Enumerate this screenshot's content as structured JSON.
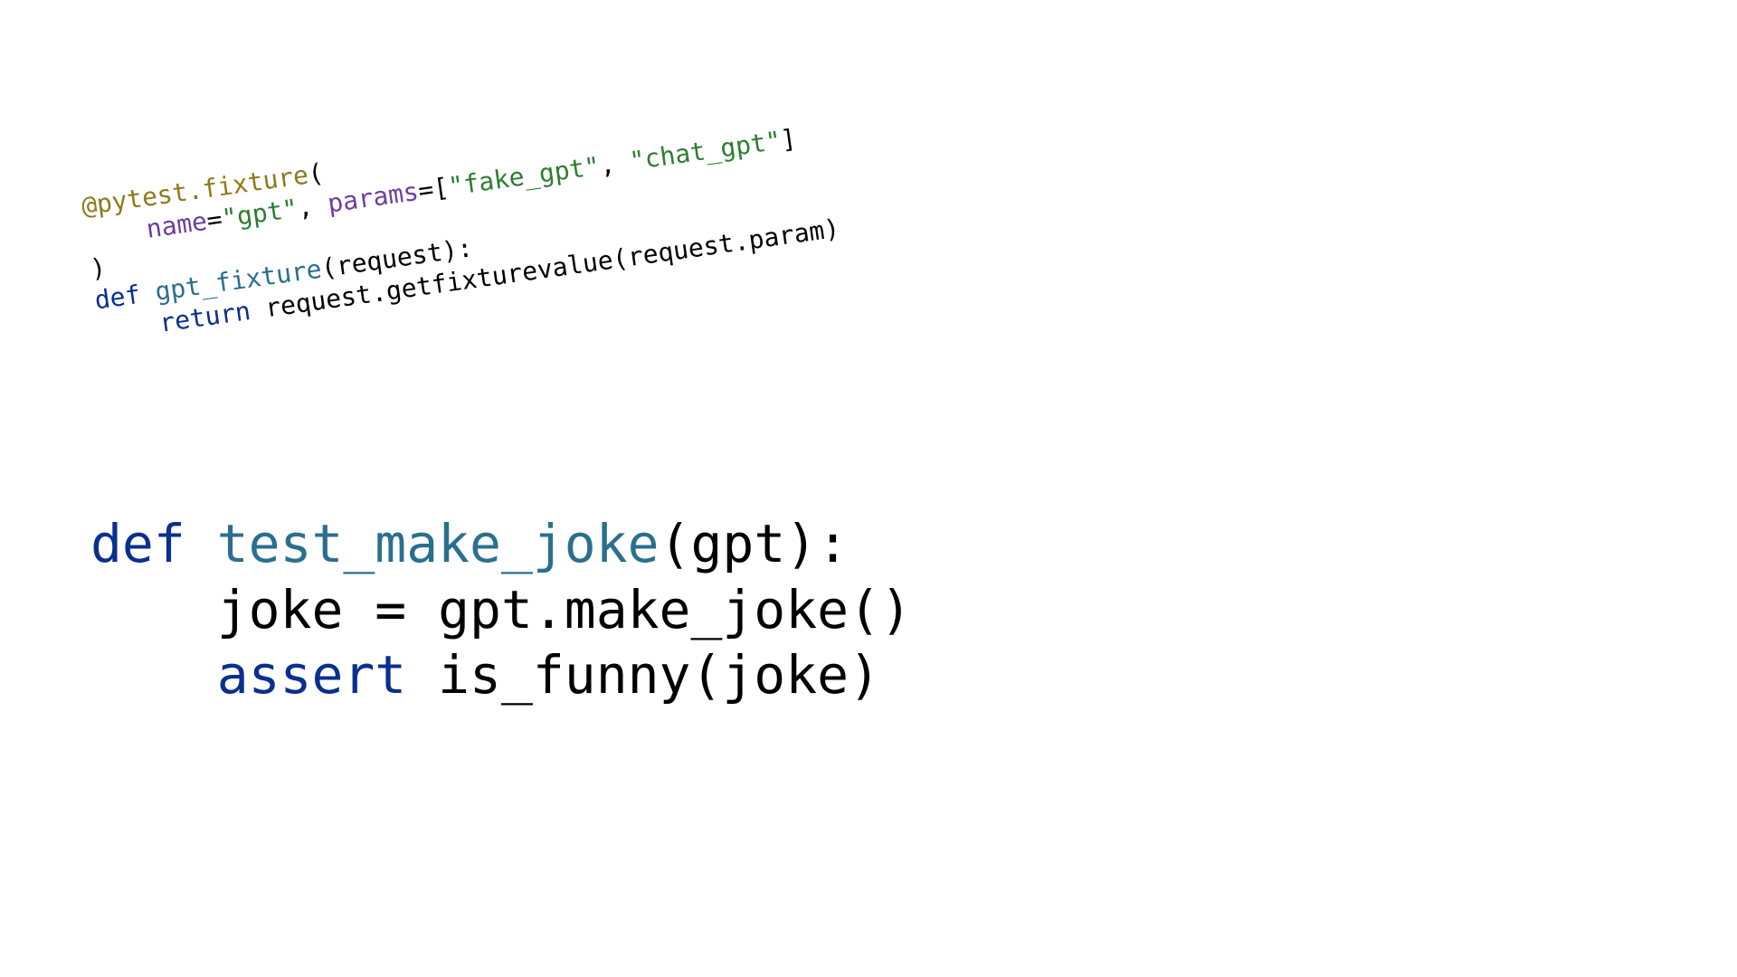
{
  "small": {
    "decorator": "@pytest.fixture",
    "lparen": "(",
    "indent1": "    ",
    "kw_name": "name",
    "eq1": "=",
    "val_name": "\"gpt\"",
    "comma_sp": ", ",
    "kw_params": "params",
    "eq2": "=[",
    "val_p1": "\"fake_gpt\"",
    "val_p2": "\"chat_gpt\"",
    "close_list": "]",
    "rparen": ")",
    "def_kw": "def",
    "sp": " ",
    "fname": "gpt_fixture",
    "sig": "(request):",
    "indent2": "    ",
    "return_kw": "return",
    "ret_expr": " request.getfixturevalue(request.param)"
  },
  "big": {
    "def_kw": "def",
    "sp": " ",
    "fname": "test_make_joke",
    "sig": "(gpt):",
    "indent": "    ",
    "line2": "joke = gpt.make_joke()",
    "assert_kw": "assert",
    "assert_rest": " is_funny(joke)"
  }
}
